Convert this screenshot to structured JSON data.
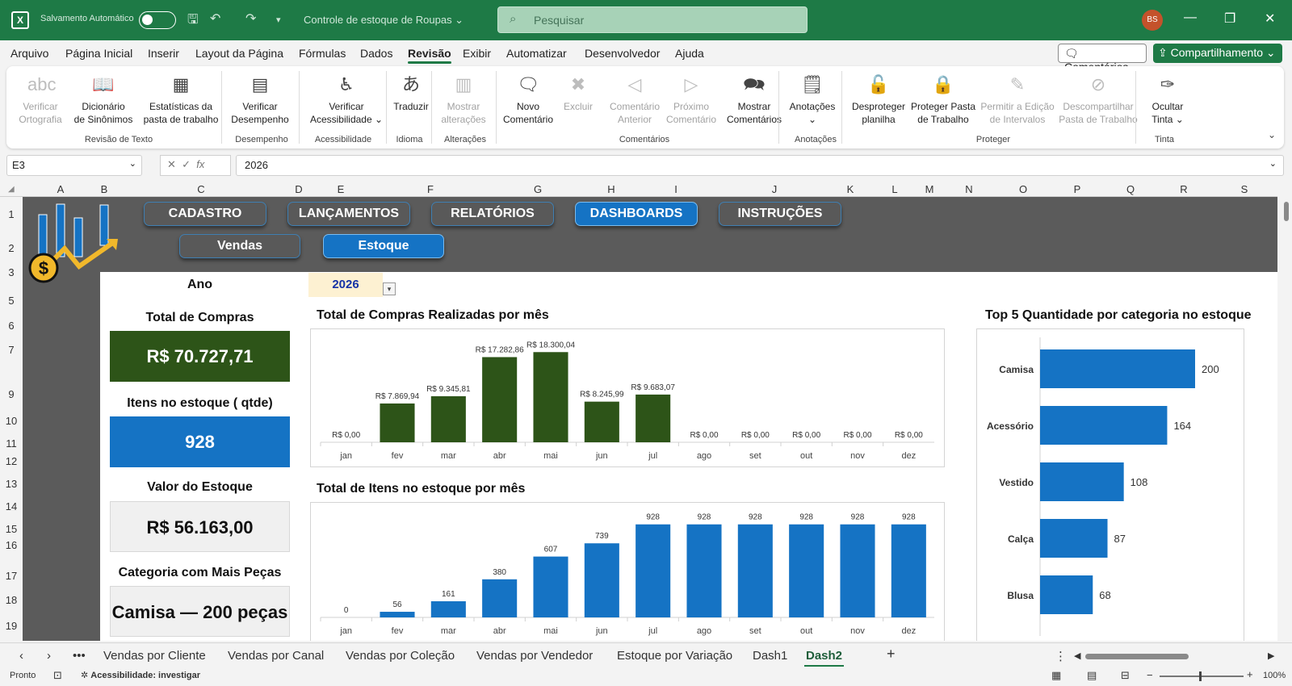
{
  "titlebar": {
    "autosave_label": "Salvamento Automático",
    "doc_title": "Controle de estoque de Roupas ⌄",
    "search_placeholder": "Pesquisar",
    "avatar_initials": "BS"
  },
  "menu": [
    "Arquivo",
    "Página Inicial",
    "Inserir",
    "Layout da Página",
    "Fórmulas",
    "Dados",
    "Revisão",
    "Exibir",
    "Automatizar",
    "Desenvolvedor",
    "Ajuda"
  ],
  "menu_active": "Revisão",
  "comments_button": "Comentários",
  "share_button": "Compartilhamento",
  "ribbon": {
    "buttons": [
      {
        "l1": "Verificar",
        "l2": "Ortografia",
        "icon": "abc-check-icon",
        "enabled": false
      },
      {
        "l1": "Dicionário",
        "l2": "de Sinônimos",
        "icon": "book-icon",
        "enabled": true
      },
      {
        "l1": "Estatísticas da",
        "l2": "pasta de trabalho",
        "icon": "stats-icon",
        "enabled": true
      },
      {
        "l1": "Verificar",
        "l2": "Desempenho",
        "icon": "performance-icon",
        "enabled": true
      },
      {
        "l1": "Verificar",
        "l2": "Acessibilidade ⌄",
        "icon": "accessibility-icon",
        "enabled": true
      },
      {
        "l1": "Traduzir",
        "l2": "",
        "icon": "translate-icon",
        "enabled": true
      },
      {
        "l1": "Mostrar",
        "l2": "alterações",
        "icon": "changes-icon",
        "enabled": false
      },
      {
        "l1": "Novo",
        "l2": "Comentário",
        "icon": "new-comment-icon",
        "enabled": true
      },
      {
        "l1": "Excluir",
        "l2": "",
        "icon": "delete-comment-icon",
        "enabled": false
      },
      {
        "l1": "Comentário",
        "l2": "Anterior",
        "icon": "prev-comment-icon",
        "enabled": false
      },
      {
        "l1": "Próximo",
        "l2": "Comentário",
        "icon": "next-comment-icon",
        "enabled": false
      },
      {
        "l1": "Mostrar",
        "l2": "Comentários",
        "icon": "show-comments-icon",
        "enabled": true
      },
      {
        "l1": "Anotações",
        "l2": "⌄",
        "icon": "notes-icon",
        "enabled": true
      },
      {
        "l1": "Desproteger",
        "l2": "planilha",
        "icon": "unprotect-sheet-icon",
        "enabled": true
      },
      {
        "l1": "Proteger Pasta",
        "l2": "de Trabalho",
        "icon": "protect-workbook-icon",
        "enabled": true
      },
      {
        "l1": "Permitir a Edição",
        "l2": "de Intervalos",
        "icon": "allow-edit-icon",
        "enabled": false
      },
      {
        "l1": "Descompartilhar",
        "l2": "Pasta de Trabalho",
        "icon": "unshare-icon",
        "enabled": false
      },
      {
        "l1": "Ocultar",
        "l2": "Tinta ⌄",
        "icon": "ink-icon",
        "enabled": true
      }
    ],
    "groups": [
      "Revisão de Texto",
      "Desempenho",
      "Acessibilidade",
      "Idioma",
      "Alterações",
      "Comentários",
      "Anotações",
      "Proteger",
      "Tinta"
    ]
  },
  "formula_bar": {
    "name_box": "E3",
    "fx": "fx",
    "value": "2026"
  },
  "columns": [
    "A",
    "B",
    "C",
    "D",
    "E",
    "F",
    "G",
    "H",
    "I",
    "J",
    "K",
    "L",
    "M",
    "N",
    "O",
    "P",
    "Q",
    "R",
    "S"
  ],
  "rows": [
    "1",
    "2",
    "3",
    "5",
    "6",
    "7",
    "9",
    "10",
    "11",
    "12",
    "13",
    "14",
    "15",
    "16",
    "17",
    "18",
    "19"
  ],
  "nav": {
    "top": [
      "CADASTRO",
      "LANÇAMENTOS",
      "RELATÓRIOS",
      "DASHBOARDS",
      "INSTRUÇÕES"
    ],
    "top_active": "DASHBOARDS",
    "sub": [
      "Vendas",
      "Estoque"
    ],
    "sub_active": "Estoque"
  },
  "dashboard": {
    "year_label": "Ano",
    "year_value": "2026",
    "kpis": [
      {
        "label": "Total de Compras",
        "value": "R$ 70.727,71",
        "bg": "#2d5418",
        "fg": "#ffffff"
      },
      {
        "label": "Itens no estoque ( qtde)",
        "value": "928",
        "bg": "#1573c4",
        "fg": "#ffffff"
      },
      {
        "label": "Valor do Estoque",
        "value": "R$ 56.163,00",
        "bg": "#f0f0f0",
        "fg": "#111111"
      },
      {
        "label": "Categoria com Mais Peças",
        "value": "Camisa — 200 peças",
        "bg": "#f0f0f0",
        "fg": "#111111"
      }
    ]
  },
  "chart_data": [
    {
      "type": "bar",
      "title": "Total de Compras Realizadas por mês",
      "color": "#2d5418",
      "categories": [
        "jan",
        "fev",
        "mar",
        "abr",
        "mai",
        "jun",
        "jul",
        "ago",
        "set",
        "out",
        "nov",
        "dez"
      ],
      "values": [
        0,
        7869.94,
        9345.81,
        17282.86,
        18300.04,
        8245.99,
        9683.07,
        0,
        0,
        0,
        0,
        0
      ],
      "data_labels": [
        "R$ 0,00",
        "R$ 7.869,94",
        "R$ 9.345,81",
        "R$ 17.282,86",
        "R$ 18.300,04",
        "R$ 8.245,99",
        "R$ 9.683,07",
        "R$ 0,00",
        "R$ 0,00",
        "R$ 0,00",
        "R$ 0,00",
        "R$ 0,00"
      ],
      "ylim": [
        0,
        19000
      ]
    },
    {
      "type": "bar",
      "title": "Total de Itens no estoque por mês",
      "color": "#1573c4",
      "categories": [
        "jan",
        "fev",
        "mar",
        "abr",
        "mai",
        "jun",
        "jul",
        "ago",
        "set",
        "out",
        "nov",
        "dez"
      ],
      "values": [
        0,
        56,
        161,
        380,
        607,
        739,
        928,
        928,
        928,
        928,
        928,
        928
      ],
      "data_labels": [
        "0",
        "56",
        "161",
        "380",
        "607",
        "739",
        "928",
        "928",
        "928",
        "928",
        "928",
        "928"
      ],
      "ylim": [
        0,
        950
      ]
    },
    {
      "type": "bar",
      "orientation": "horizontal",
      "title": "Top 5 Quantidade por categoria no estoque",
      "color": "#1573c4",
      "categories": [
        "Camisa",
        "Acessório",
        "Vestido",
        "Calça",
        "Blusa"
      ],
      "values": [
        200,
        164,
        108,
        87,
        68
      ],
      "xlim": [
        0,
        200
      ]
    }
  ],
  "sheet_tabs": [
    "Vendas por Cliente",
    "Vendas por Canal",
    "Vendas por Coleção",
    "Vendas por Vendedor",
    "Estoque por Variação",
    "Dash1",
    "Dash2"
  ],
  "sheet_tab_active": "Dash2",
  "status": {
    "ready": "Pronto",
    "accessibility": "Acessibilidade: investigar",
    "zoom": "100%"
  }
}
